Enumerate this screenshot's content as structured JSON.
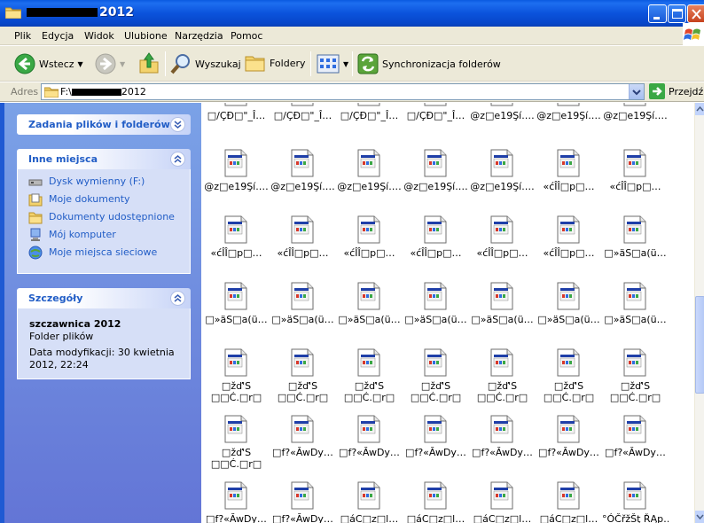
{
  "window": {
    "title_prefix": "",
    "title_suffix": "2012"
  },
  "menu": [
    "Plik",
    "Edycja",
    "Widok",
    "Ulubione",
    "Narzędzia",
    "Pomoc"
  ],
  "toolbar": {
    "back_label": "Wstecz",
    "search_label": "Wyszukaj",
    "folders_label": "Foldery",
    "sync_label": "Synchronizacja folderów"
  },
  "address": {
    "label": "Adres",
    "path_prefix": "F:\\",
    "path_suffix": "2012",
    "go_label": "Przejdź"
  },
  "tasks_panel": {
    "title": "Zadania plików i folderów"
  },
  "places_panel": {
    "title": "Inne miejsca",
    "items": [
      {
        "label": "Dysk wymienny (F:)",
        "icon": "removable-drive-icon"
      },
      {
        "label": "Moje dokumenty",
        "icon": "my-documents-icon"
      },
      {
        "label": "Dokumenty udostępnione",
        "icon": "shared-documents-icon"
      },
      {
        "label": "Mój komputer",
        "icon": "my-computer-icon"
      },
      {
        "label": "Moje miejsca sieciowe",
        "icon": "network-places-icon"
      }
    ]
  },
  "details_panel": {
    "title": "Szczegóły",
    "name": "szczawnica 2012",
    "type": "Folder plików",
    "modified": "Data modyfikacji: 30 kwietnia 2012, 22:24"
  },
  "files": {
    "rows": [
      [
        "□/ÇĐ□\"_Î…",
        "□/ÇĐ□\"_Î…",
        "□/ÇĐ□\"_Î…",
        "□/ÇĐ□\"_Î…",
        "@z□e19Şí.…",
        "@z□e19Şí.…",
        "@z□e19Şí.…"
      ],
      [
        "@z□e19Şí.…",
        "@z□e19Şí.…",
        "@z□e19Şí.…",
        "@z□e19Şí.…",
        "@z□e19Şí.…",
        "«ćÎÎ□p□…",
        "«ćÎÎ□p□…"
      ],
      [
        "«ćÎÎ□p□…",
        "«ćÎÎ□p□…",
        "«ćÎÎ□p□…",
        "«ćÎÎ□p□…",
        "«ćÎÎ□p□…",
        "«ćÎÎ□p□…",
        "□»äS□a(ü…"
      ],
      [
        "□»äS□a(ü…",
        "□»äS□a(ü…",
        "□»äS□a(ü…",
        "□»äS□a(ü…",
        "□»äS□a(ü…",
        "□»äS□a(ü…",
        "□»äS□a(ü…"
      ],
      [
        "□žď'S\n□□Ć.□r□",
        "□žď'S\n□□Ć.□r□",
        "□žď'S\n□□Ć.□r□",
        "□žď'S\n□□Ć.□r□",
        "□žď'S\n□□Ć.□r□",
        "□žď'S\n□□Ć.□r□",
        "□žď'S\n□□Ć.□r□"
      ],
      [
        "□žď'S\n□□Ć.□r□",
        "□f?«ĂwDy…",
        "□f?«ĂwDy…",
        "□f?«ĂwDy…",
        "□f?«ĂwDy…",
        "□f?«ĂwDy…",
        "□f?«ĂwDy…"
      ],
      [
        "□f?«ĂwDy…",
        "□f?«ĂwDy…",
        "□áC□z□l…",
        "□áC□z□l…",
        "□áC□z□l…",
        "□áC□z□l…",
        "°ÓČřžŠţ ŘĄp…"
      ]
    ]
  }
}
